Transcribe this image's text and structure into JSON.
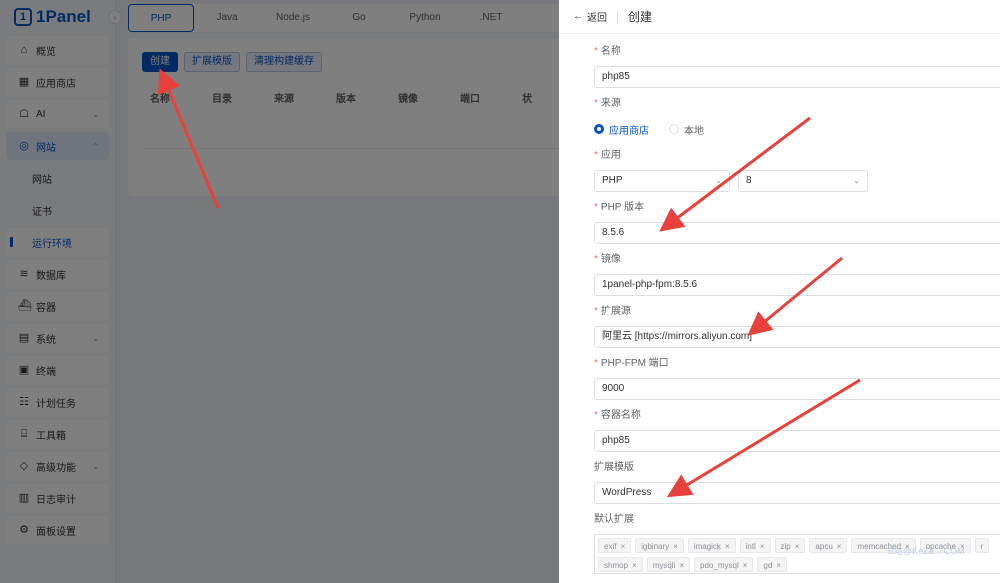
{
  "app": {
    "logo": "1Panel",
    "logo_mark": "1"
  },
  "sidebar": {
    "items": [
      {
        "label": "概览",
        "icon": "home-icon",
        "glyph": "⌂"
      },
      {
        "label": "应用商店",
        "icon": "grid-icon",
        "glyph": "▦"
      },
      {
        "label": "AI",
        "icon": "robot-icon",
        "glyph": "☖",
        "chevron": "⌄"
      },
      {
        "label": "网站",
        "icon": "globe-icon",
        "glyph": "◎",
        "chevron": "⌃"
      },
      {
        "label": "网站",
        "sub": true
      },
      {
        "label": "证书",
        "sub": true
      },
      {
        "label": "运行环境",
        "sub": true
      },
      {
        "label": "数据库",
        "icon": "database-icon",
        "glyph": "≋"
      },
      {
        "label": "容器",
        "icon": "container-icon",
        "glyph": "⛴"
      },
      {
        "label": "系统",
        "icon": "system-icon",
        "glyph": "▤",
        "chevron": "⌄"
      },
      {
        "label": "终端",
        "icon": "terminal-icon",
        "glyph": "▣"
      },
      {
        "label": "计划任务",
        "icon": "cron-icon",
        "glyph": "☷"
      },
      {
        "label": "工具箱",
        "icon": "toolbox-icon",
        "glyph": "⌸"
      },
      {
        "label": "高级功能",
        "icon": "diamond-icon",
        "glyph": "◇",
        "chevron": "⌄"
      },
      {
        "label": "日志审计",
        "icon": "log-icon",
        "glyph": "▥"
      },
      {
        "label": "面板设置",
        "icon": "settings-icon",
        "glyph": "⚙"
      }
    ]
  },
  "runtime_tabs": [
    "PHP",
    "Java",
    "Node.js",
    "Go",
    "Python",
    ".NET"
  ],
  "toolbar": {
    "create": "创建",
    "ext_template": "扩展模版",
    "clear_cache": "清理构建缓存"
  },
  "table_columns": [
    "名称",
    "目录",
    "来源",
    "版本",
    "镜像",
    "端口",
    "状"
  ],
  "drawer": {
    "back": "返回",
    "title": "创建",
    "fields": {
      "name": {
        "label": "名称",
        "value": "php85"
      },
      "source": {
        "label": "来源",
        "options": [
          "应用商店",
          "本地"
        ],
        "selected": "应用商店"
      },
      "app": {
        "label": "应用",
        "app_value": "PHP",
        "version_value": "8"
      },
      "php_version": {
        "label": "PHP 版本",
        "value": "8.5.6"
      },
      "image": {
        "label": "镜像",
        "value": "1panel-php-fpm:8.5.6"
      },
      "ext_source": {
        "label": "扩展源",
        "value": "阿里云 [https://mirrors.aliyun.com]"
      },
      "fpm_port": {
        "label": "PHP-FPM 端口",
        "value": "9000"
      },
      "container_name": {
        "label": "容器名称",
        "value": "php85"
      },
      "ext_template": {
        "label": "扩展模版",
        "value": "WordPress"
      },
      "default_ext": {
        "label": "默认扩展",
        "tags": [
          "exif",
          "igbinary",
          "imagick",
          "intl",
          "zip",
          "apcu",
          "memcached",
          "opcache",
          "r",
          "shmop",
          "mysqli",
          "pdo_mysql",
          "gd"
        ]
      }
    }
  },
  "watermark": "B站@KeZa... COM",
  "colors": {
    "primary": "#0854c7",
    "required": "#f56c6c",
    "arrow": "#e8403a"
  }
}
